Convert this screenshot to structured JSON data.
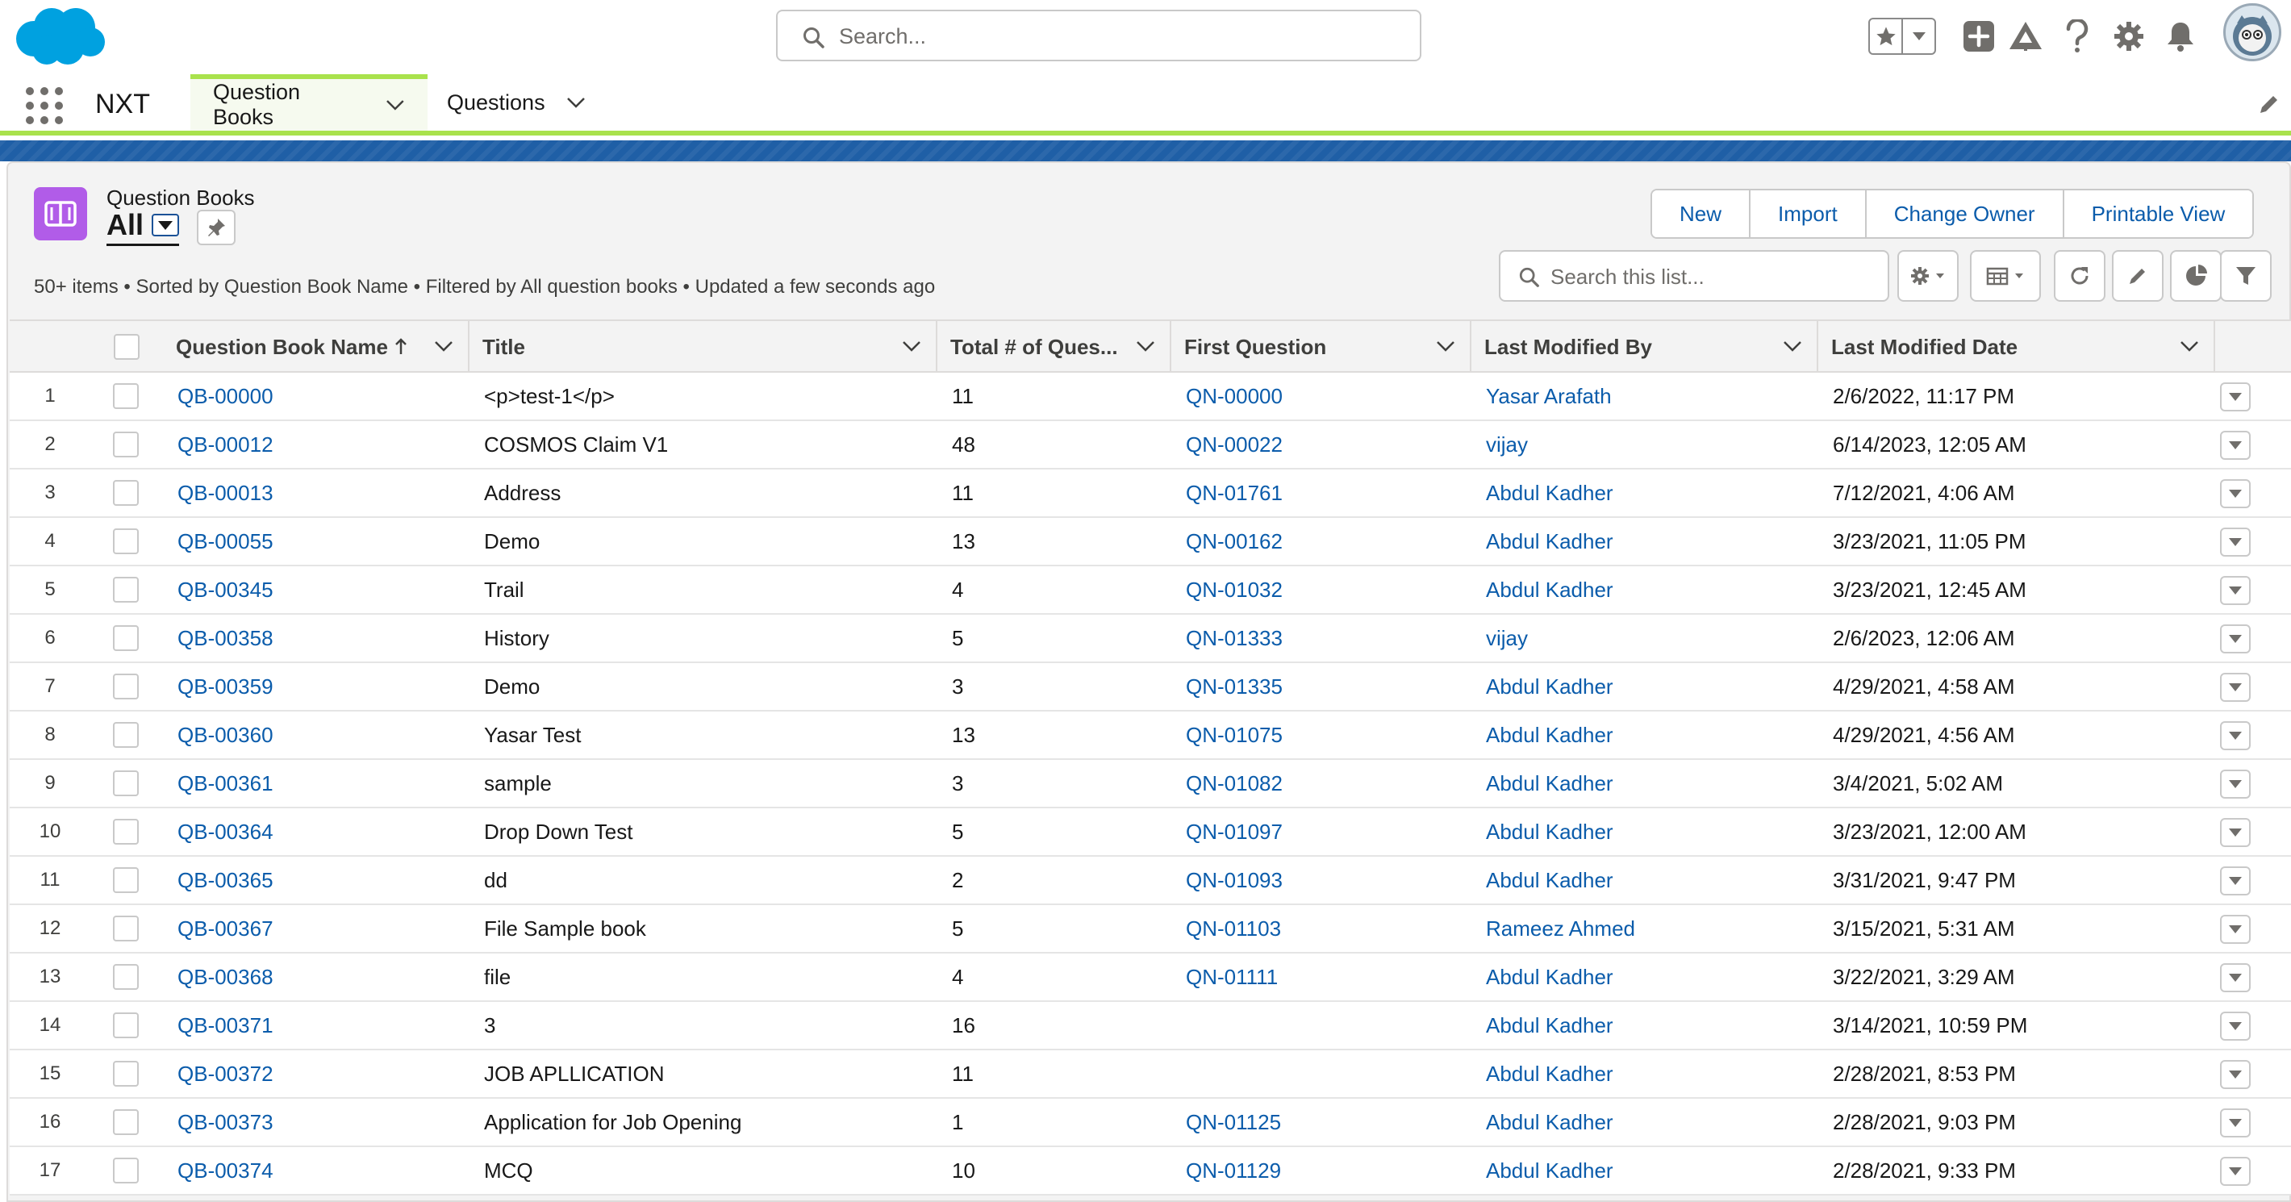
{
  "header": {
    "search_placeholder": "Search...",
    "icons": [
      "favorites-star-icon",
      "favorites-menu-chevron-icon",
      "global-actions-add-icon",
      "trailhead-icon",
      "help-icon",
      "setup-gear-icon",
      "notifications-bell-icon",
      "user-avatar"
    ]
  },
  "app_nav": {
    "app_name": "NXT",
    "tabs": [
      {
        "label": "Question Books",
        "active": true
      },
      {
        "label": "Questions",
        "active": false
      }
    ]
  },
  "list_view": {
    "object_name": "Question Books",
    "view_name": "All",
    "meta": "50+ items • Sorted by Question Book Name • Filtered by All question books • Updated a few seconds ago",
    "buttons": [
      "New",
      "Import",
      "Change Owner",
      "Printable View"
    ],
    "search_placeholder": "Search this list...",
    "tool_icons": [
      "list-view-controls-gear-icon",
      "display-as-table-icon",
      "refresh-icon",
      "inline-edit-pencil-icon",
      "charts-icon",
      "filters-icon"
    ],
    "columns": [
      "Question Book Name",
      "Title",
      "Total # of Ques...",
      "First Question",
      "Last Modified By",
      "Last Modified Date"
    ],
    "sorted_column": "Question Book Name",
    "rows": [
      {
        "n": "1",
        "name": "QB-00000",
        "title": "<p>test-1</p>",
        "total": "11",
        "first": "QN-00000",
        "by": "Yasar Arafath",
        "date": "2/6/2022, 11:17 PM"
      },
      {
        "n": "2",
        "name": "QB-00012",
        "title": "COSMOS Claim V1",
        "total": "48",
        "first": "QN-00022",
        "by": "vijay",
        "date": "6/14/2023, 12:05 AM"
      },
      {
        "n": "3",
        "name": "QB-00013",
        "title": "Address",
        "total": "11",
        "first": "QN-01761",
        "by": "Abdul Kadher",
        "date": "7/12/2021, 4:06 AM"
      },
      {
        "n": "4",
        "name": "QB-00055",
        "title": "Demo",
        "total": "13",
        "first": "QN-00162",
        "by": "Abdul Kadher",
        "date": "3/23/2021, 11:05 PM"
      },
      {
        "n": "5",
        "name": "QB-00345",
        "title": "Trail",
        "total": "4",
        "first": "QN-01032",
        "by": "Abdul Kadher",
        "date": "3/23/2021, 12:45 AM"
      },
      {
        "n": "6",
        "name": "QB-00358",
        "title": "History",
        "total": "5",
        "first": "QN-01333",
        "by": "vijay",
        "date": "2/6/2023, 12:06 AM"
      },
      {
        "n": "7",
        "name": "QB-00359",
        "title": "Demo",
        "total": "3",
        "first": "QN-01335",
        "by": "Abdul Kadher",
        "date": "4/29/2021, 4:58 AM"
      },
      {
        "n": "8",
        "name": "QB-00360",
        "title": "Yasar Test",
        "total": "13",
        "first": "QN-01075",
        "by": "Abdul Kadher",
        "date": "4/29/2021, 4:56 AM"
      },
      {
        "n": "9",
        "name": "QB-00361",
        "title": "sample",
        "total": "3",
        "first": "QN-01082",
        "by": "Abdul Kadher",
        "date": "3/4/2021, 5:02 AM"
      },
      {
        "n": "10",
        "name": "QB-00364",
        "title": "Drop Down Test",
        "total": "5",
        "first": "QN-01097",
        "by": "Abdul Kadher",
        "date": "3/23/2021, 12:00 AM"
      },
      {
        "n": "11",
        "name": "QB-00365",
        "title": "dd",
        "total": "2",
        "first": "QN-01093",
        "by": "Abdul Kadher",
        "date": "3/31/2021, 9:47 PM"
      },
      {
        "n": "12",
        "name": "QB-00367",
        "title": "File Sample book",
        "total": "5",
        "first": "QN-01103",
        "by": "Rameez Ahmed",
        "date": "3/15/2021, 5:31 AM"
      },
      {
        "n": "13",
        "name": "QB-00368",
        "title": "file",
        "total": "4",
        "first": "QN-01111",
        "by": "Abdul Kadher",
        "date": "3/22/2021, 3:29 AM"
      },
      {
        "n": "14",
        "name": "QB-00371",
        "title": "3",
        "total": "16",
        "first": "",
        "by": "Abdul Kadher",
        "date": "3/14/2021, 10:59 PM"
      },
      {
        "n": "15",
        "name": "QB-00372",
        "title": "JOB APLLICATION",
        "total": "11",
        "first": "",
        "by": "Abdul Kadher",
        "date": "2/28/2021, 8:53 PM"
      },
      {
        "n": "16",
        "name": "QB-00373",
        "title": "Application for Job Opening",
        "total": "1",
        "first": "QN-01125",
        "by": "Abdul Kadher",
        "date": "2/28/2021, 9:03 PM"
      },
      {
        "n": "17",
        "name": "QB-00374",
        "title": "MCQ",
        "total": "10",
        "first": "QN-01129",
        "by": "Abdul Kadher",
        "date": "2/28/2021, 9:33 PM"
      }
    ]
  },
  "colors": {
    "link": "#0b5cab",
    "brand_blue": "#1f5fa6",
    "nav_accent": "#a9e24c",
    "object_icon": "#b15ce8",
    "logo": "#00a1e0"
  }
}
